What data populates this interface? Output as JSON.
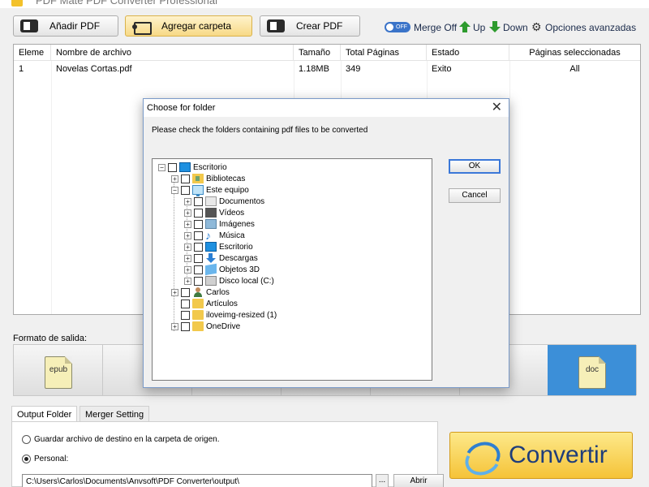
{
  "app": {
    "title": "PDF Mate PDF Converter Professional"
  },
  "toolbar": {
    "add_pdf": "Añadir PDF",
    "add_folder": "Agregar carpeta",
    "create_pdf": "Crear PDF",
    "merge_toggle": "OFF",
    "merge_label": "Merge Off",
    "up_label": "Up",
    "down_label": "Down",
    "advanced_label": "Opciones avanzadas"
  },
  "file_table": {
    "columns": [
      "Eleme",
      "Nombre de archivo",
      "Tamaño",
      "Total Páginas",
      "Estado",
      "Páginas seleccionadas"
    ],
    "rows": [
      {
        "index": "1",
        "name": "Novelas Cortas.pdf",
        "size": "1.18MB",
        "pages": "349",
        "status": "Exito",
        "selected": "All"
      }
    ]
  },
  "output_format": {
    "label": "Formato de salida:",
    "formats": [
      "epub",
      "doc"
    ],
    "selected": "doc"
  },
  "bottom_tabs": {
    "tabs": [
      "Output Folder",
      "Merger Setting"
    ],
    "radio_source": "Guardar archivo de destino en la carpeta de origen.",
    "radio_custom": "Personal:",
    "path_value": "C:\\Users\\Carlos\\Documents\\Anvsoft\\PDF Converter\\output\\",
    "browse": "...",
    "open": "Abrir"
  },
  "convert": {
    "label": "Convertir"
  },
  "dialog": {
    "title": "Choose for folder",
    "message": "Please check the folders containing  pdf files to be converted",
    "ok": "OK",
    "cancel": "Cancel",
    "tree": [
      {
        "label": "Escritorio",
        "icon": "desktop-icon"
      },
      {
        "label": "Bibliotecas",
        "icon": "library-icon"
      },
      {
        "label": "Este equipo",
        "icon": "computer-icon"
      },
      {
        "label": "Documentos",
        "icon": "documents-icon"
      },
      {
        "label": "Vídeos",
        "icon": "videos-icon"
      },
      {
        "label": "Imágenes",
        "icon": "pictures-icon"
      },
      {
        "label": "Música",
        "icon": "music-icon"
      },
      {
        "label": "Escritorio",
        "icon": "desktop-icon"
      },
      {
        "label": "Descargas",
        "icon": "downloads-icon"
      },
      {
        "label": "Objetos 3D",
        "icon": "objects-3d-icon"
      },
      {
        "label": "Disco local (C:)",
        "icon": "disk-icon"
      },
      {
        "label": "Carlos",
        "icon": "user-icon"
      },
      {
        "label": "Artículos",
        "icon": "folder-icon"
      },
      {
        "label": "iloveimg-resized (1)",
        "icon": "folder-icon"
      },
      {
        "label": "OneDrive",
        "icon": "folder-icon"
      }
    ]
  }
}
